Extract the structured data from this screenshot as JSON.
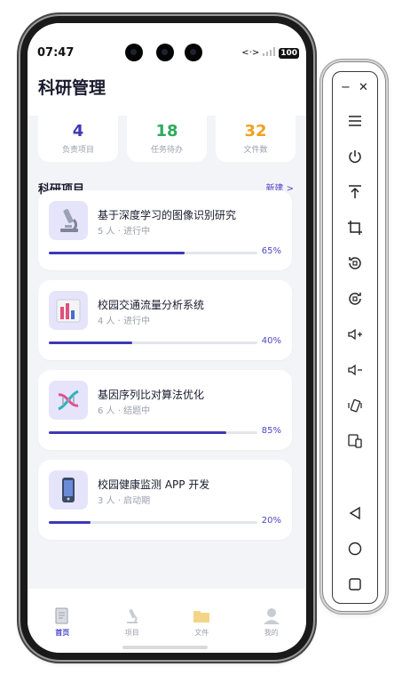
{
  "status_bar": {
    "time": "07:47",
    "battery": "100"
  },
  "app": {
    "title": "科研管理"
  },
  "stats": [
    {
      "value": "4",
      "label": "负责项目",
      "color": "#3f38b5"
    },
    {
      "value": "18",
      "label": "任务待办",
      "color": "#2eaa5c"
    },
    {
      "value": "32",
      "label": "文件数",
      "color": "#f0a020"
    }
  ],
  "section": {
    "title": "科研项目",
    "new_link": "新建 >"
  },
  "projects": [
    {
      "name": "基于深度学习的图像识别研究",
      "meta": "5 人 · 进行中",
      "progress": 0.65,
      "progress_label": "65%",
      "icon": "microscope-icon"
    },
    {
      "name": "校园交通流量分析系统",
      "meta": "4 人 · 进行中",
      "progress": 0.4,
      "progress_label": "40%",
      "icon": "bar-chart-icon"
    },
    {
      "name": "基因序列比对算法优化",
      "meta": "6 人 · 结题中",
      "progress": 0.85,
      "progress_label": "85%",
      "icon": "dna-icon"
    },
    {
      "name": "校园健康监测 APP 开发",
      "meta": "3 人 · 启动期",
      "progress": 0.2,
      "progress_label": "20%",
      "icon": "phone-icon"
    }
  ],
  "tabs": [
    {
      "label": "首页",
      "icon": "document-icon",
      "active": true
    },
    {
      "label": "项目",
      "icon": "microscope-icon",
      "active": false
    },
    {
      "label": "文件",
      "icon": "folder-icon",
      "active": false
    },
    {
      "label": "我的",
      "icon": "user-icon",
      "active": false
    }
  ],
  "toolbar": {
    "minimize": "−",
    "close": "✕"
  },
  "colors": {
    "accent": "#4c46c9",
    "progress": "#3f38b5",
    "bg": "#f3f4f8"
  }
}
